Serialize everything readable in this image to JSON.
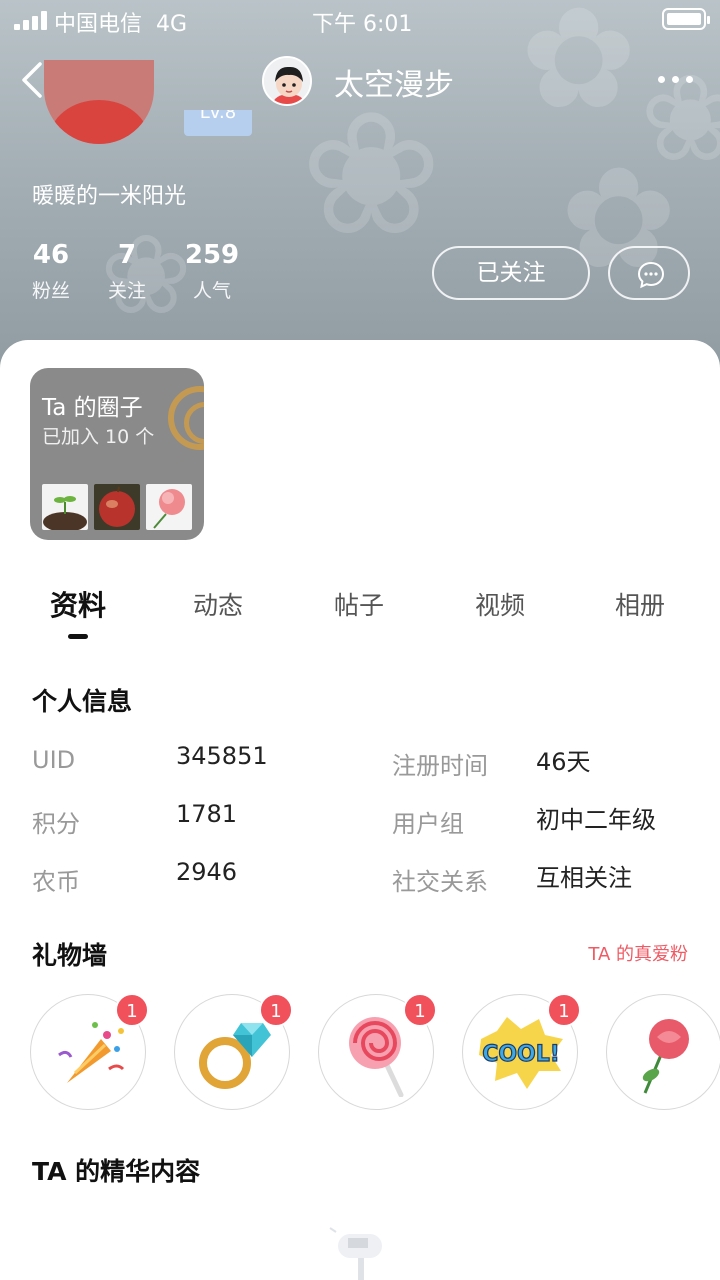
{
  "statusbar": {
    "carrier": "中国电信",
    "network": "4G",
    "time": "下午 6:01"
  },
  "navbar": {
    "title": "太空漫步",
    "back_icon": "chevron-left-icon",
    "more_icon": "ellipsis-icon"
  },
  "profile": {
    "level": "Lv.8",
    "signature": "暖暖的一米阳光",
    "stats": [
      {
        "value": "46",
        "label": "粉丝"
      },
      {
        "value": "7",
        "label": "关注"
      },
      {
        "value": "259",
        "label": "人气"
      }
    ],
    "follow_button": "已关注"
  },
  "circles": {
    "title": "Ta 的圈子",
    "subtitle": "已加入 10 个"
  },
  "tabs": [
    "资料",
    "动态",
    "帖子",
    "视频",
    "相册"
  ],
  "personal_info": {
    "title": "个人信息",
    "rows": [
      {
        "label": "UID",
        "value": "345851"
      },
      {
        "label": "注册时间",
        "value": "46天"
      },
      {
        "label": "积分",
        "value": "1781"
      },
      {
        "label": "用户组",
        "value": "初中二年级"
      },
      {
        "label": "农币",
        "value": "2946"
      },
      {
        "label": "社交关系",
        "value": "互相关注"
      }
    ]
  },
  "gift_wall": {
    "title": "礼物墙",
    "link": "TA 的真爱粉",
    "gifts": [
      {
        "icon": "party-popper-icon",
        "count": "1"
      },
      {
        "icon": "diamond-ring-icon",
        "count": "1"
      },
      {
        "icon": "lollipop-icon",
        "count": "1"
      },
      {
        "icon": "cool-sticker-icon",
        "count": "1"
      },
      {
        "icon": "rose-icon",
        "count": ""
      }
    ]
  },
  "featured": {
    "title": "TA 的精华内容"
  },
  "colors": {
    "accent_red": "#f0515b",
    "hero_bg": "#a4afb5",
    "circle_card_bg": "#8a8a8a"
  }
}
